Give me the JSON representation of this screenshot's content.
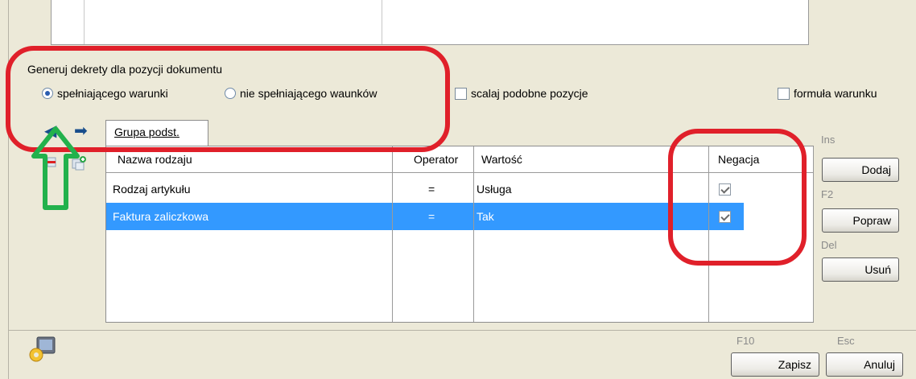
{
  "section": {
    "caption": "Generuj dekrety dla pozycji dokumentu",
    "radio_meeting": "spełniającego warunki",
    "radio_not_meeting": "nie spełniającego waunków",
    "merge_label": "scalaj podobne pozycje",
    "formula_label": "formuła warunku"
  },
  "tab": {
    "label": "Grupa podst."
  },
  "grid": {
    "headers": [
      "Nazwa rodzaju",
      "Operator",
      "Wartość",
      "Negacja"
    ],
    "rows": [
      {
        "name": "Rodzaj artykułu",
        "operator": "=",
        "value": "Usługa",
        "negation": true
      },
      {
        "name": "Faktura zaliczkowa",
        "operator": "=",
        "value": "Tak",
        "negation": true
      }
    ]
  },
  "buttons": {
    "add": {
      "key": "Ins",
      "label": "Dodaj"
    },
    "edit": {
      "key": "F2",
      "label": "Popraw"
    },
    "delete": {
      "key": "Del",
      "label": "Usuń"
    },
    "save": {
      "key": "F10",
      "label": "Zapisz"
    },
    "cancel": {
      "key": "Esc",
      "label": "Anuluj"
    }
  },
  "colors": {
    "selection": "#3399ff",
    "annotation_red": "#e0202a",
    "annotation_green": "#22b14c"
  }
}
